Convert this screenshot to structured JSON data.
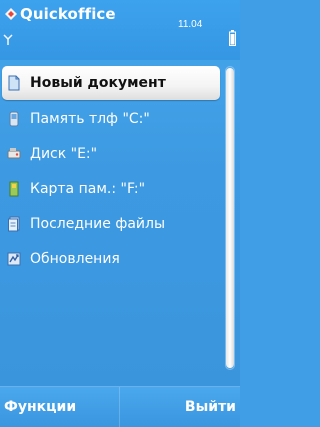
{
  "app": {
    "title": "Quickoffice",
    "icon": "quickoffice-logo-icon"
  },
  "status": {
    "clock": "11.04",
    "signal_icon": "signal-antenna-icon",
    "battery_icon": "battery-icon"
  },
  "list": {
    "items": [
      {
        "label": "Новый документ",
        "icon": "new-document-icon",
        "selected": true
      },
      {
        "label": "Память тлф \"C:\"",
        "icon": "phone-memory-icon",
        "selected": false
      },
      {
        "label": "Диск \"E:\"",
        "icon": "drive-icon",
        "selected": false
      },
      {
        "label": "Карта пам.: \"F:\"",
        "icon": "memory-card-icon",
        "selected": false
      },
      {
        "label": "Последние файлы",
        "icon": "recent-files-icon",
        "selected": false
      },
      {
        "label": "Обновления",
        "icon": "updates-icon",
        "selected": false
      }
    ]
  },
  "softkeys": {
    "left": "Функции",
    "right": "Выйти"
  },
  "colors": {
    "background": "#3f9ee6",
    "selection": "#ffffff",
    "text": "#ffffff"
  }
}
